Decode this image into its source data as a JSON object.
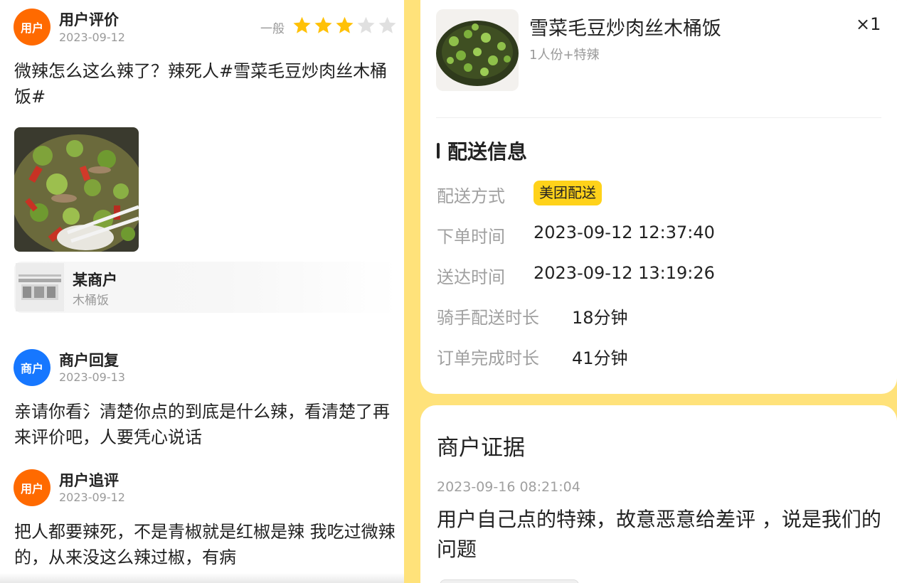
{
  "review": {
    "avatar": "用户",
    "user_label": "用户评价",
    "date": "2023-09-12",
    "rating_label": "一般",
    "rating": 3,
    "rating_max": 5,
    "text": "微辣怎么这么辣了？辣死人#雪菜毛豆炒肉丝木桶饭#"
  },
  "shop": {
    "name": "某商户",
    "category": "木桶饭"
  },
  "reply": {
    "avatar": "商户",
    "label": "商户回复",
    "date": "2023-09-13",
    "text": "亲请你看氵清楚你点的到底是什么辣，看清楚了再来评价吧，人要凭心说话"
  },
  "followup": {
    "avatar": "用户",
    "label": "用户追评",
    "date": "2023-09-12",
    "text": "把人都要辣死，不是青椒就是红椒是辣 我吃过微辣的，从来没这么辣过椒，有病"
  },
  "product": {
    "name": "雪菜毛豆炒肉丝木桶饭",
    "spec": "1人份+特辣",
    "qty": "×1"
  },
  "delivery": {
    "title": "配送信息",
    "rows": [
      {
        "label": "配送方式",
        "value": "美团配送"
      },
      {
        "label": "下单时间",
        "value": "2023-09-12 12:37:40"
      },
      {
        "label": "送达时间",
        "value": "2023-09-12 13:19:26"
      },
      {
        "label": "骑手配送时长",
        "value": "18分钟"
      },
      {
        "label": "订单完成时长",
        "value": "41分钟"
      }
    ]
  },
  "evidence": {
    "title": "商户证据",
    "date": "2023-09-16 08:21:04",
    "text": "用户自己点的特辣，故意恶意给差评 ，说是我们的问题"
  },
  "colors": {
    "user_avatar": "#ff6a00",
    "merchant_avatar": "#1677ff",
    "star_on": "#ffc107",
    "star_off": "#e0e0e0",
    "badge": "#ffd21a",
    "panel_bg": "#ffe27a"
  }
}
